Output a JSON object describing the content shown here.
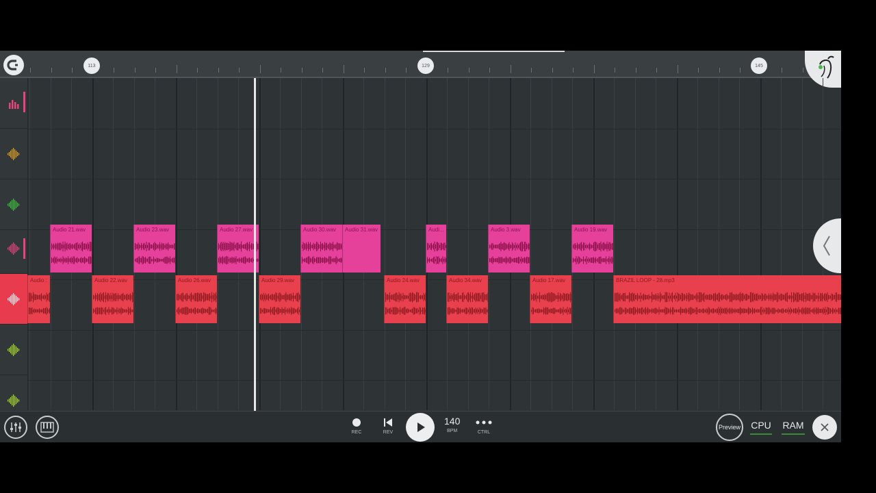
{
  "ruler": {
    "bar_markers": [
      {
        "label": "113"
      },
      {
        "label": "129"
      },
      {
        "label": "145"
      }
    ]
  },
  "clips": [
    {
      "label": "Audio 21.wav",
      "color": "pink"
    },
    {
      "label": "Audio 23.wav",
      "color": "pink"
    },
    {
      "label": "Audio 27.wav",
      "color": "pink"
    },
    {
      "label": "Audio 30.wav",
      "color": "pink"
    },
    {
      "label": "Audio 31.wav",
      "color": "pink"
    },
    {
      "label": "Audi...",
      "color": "pink"
    },
    {
      "label": "Audio 3.wav",
      "color": "pink"
    },
    {
      "label": "Audio 19.wav",
      "color": "pink"
    },
    {
      "label": "Audio :",
      "color": "red"
    },
    {
      "label": "Audio 22.wav",
      "color": "red"
    },
    {
      "label": "Audio 26.wav",
      "color": "red"
    },
    {
      "label": "Audio 29.wav",
      "color": "red"
    },
    {
      "label": "Audio 24.wav",
      "color": "red"
    },
    {
      "label": "Audio 34.wav",
      "color": "red"
    },
    {
      "label": "Audio 17.wav",
      "color": "red"
    },
    {
      "label": "BRAZIL LOOP - 28.mp3",
      "color": "red"
    }
  ],
  "tracks": [
    {
      "icon": "bar-chart-icon",
      "color": "#e8437a"
    },
    {
      "icon": "waveform-icon",
      "color": "#e0a020"
    },
    {
      "icon": "waveform-icon",
      "color": "#3fbf3f"
    },
    {
      "icon": "waveform-icon",
      "color": "#e8437a"
    },
    {
      "icon": "waveform-icon",
      "color": "#ffffff"
    },
    {
      "icon": "waveform-icon",
      "color": "#a8d820"
    },
    {
      "icon": "waveform-icon",
      "color": "#a8d820"
    }
  ],
  "toolbar": {
    "rec": "REC",
    "rev": "REV",
    "bpm_value": "140",
    "bpm_label": "BPM",
    "ctrl": "CTRL",
    "preview": "Preview",
    "cpu": "CPU",
    "ram": "RAM"
  }
}
